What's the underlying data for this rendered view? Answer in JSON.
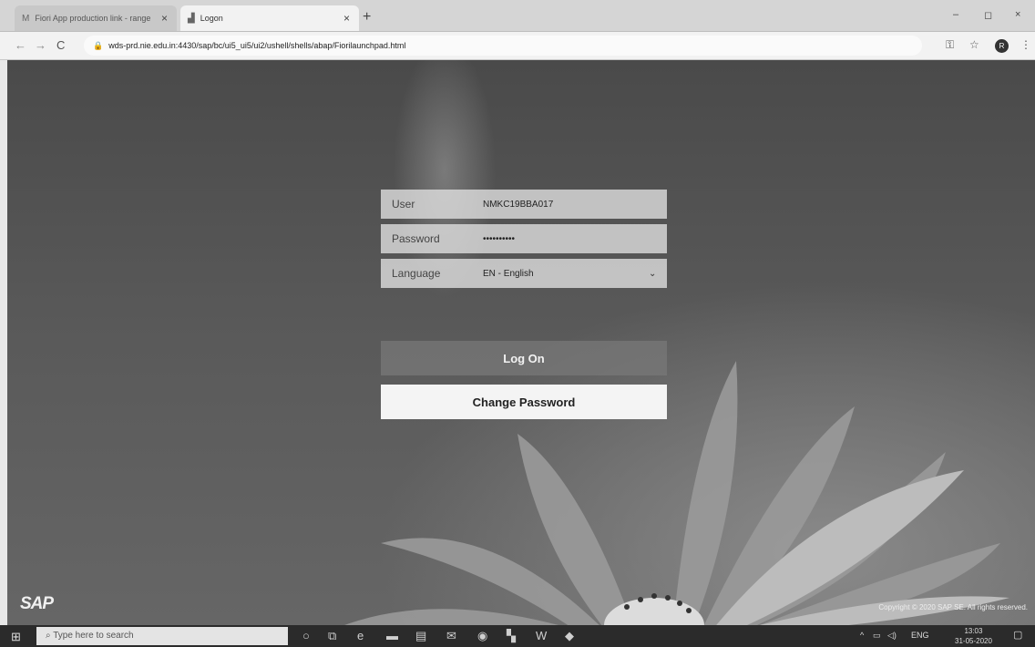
{
  "browser": {
    "tabs": [
      {
        "icon": "M",
        "label": "Fiori App production link - range"
      },
      {
        "icon": "📶",
        "label": "Logon"
      }
    ],
    "new_tab": "+",
    "url": "wds-prd.nie.edu.in:4430/sap/bc/ui5_ui5/ui2/ushell/shells/abap/Fiorilaunchpad.html",
    "window_controls": [
      "–",
      "◻",
      "×"
    ],
    "profile_initial": "R"
  },
  "login": {
    "user_label": "User",
    "user_value": "NMKC19BBA017",
    "password_label": "Password",
    "password_value": "••••••••••",
    "language_label": "Language",
    "language_value": "EN - English",
    "logon_button": "Log On",
    "change_password_button": "Change Password"
  },
  "footer": {
    "logo": "SAP",
    "copyright": "Copyright © 2020 SAP SE. All rights reserved."
  },
  "taskbar": {
    "search_placeholder": "Type here to search",
    "language": "ENG",
    "time": "13:03",
    "date": "31-05-2020"
  }
}
